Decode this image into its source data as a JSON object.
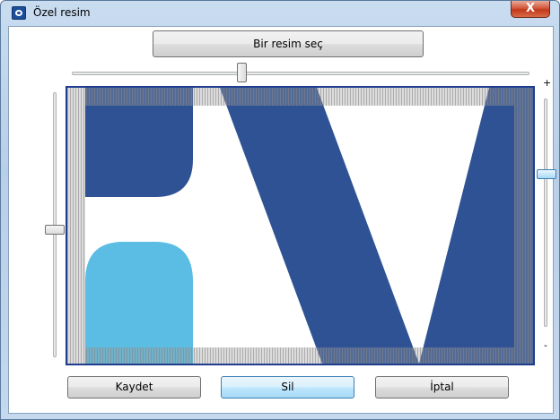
{
  "window": {
    "title": "Özel resim",
    "close_label": "X"
  },
  "toolbar": {
    "choose_image_label": "Bir resim seç"
  },
  "zoom": {
    "plus_label": "+",
    "minus_label": "-",
    "level": 0.55
  },
  "crop": {
    "horizontal_position": 0.37,
    "vertical_position": 0.5
  },
  "colors": {
    "dark_blue": "#2f5294",
    "light_blue": "#5bbde3",
    "frame_border": "#1f3d8f"
  },
  "actions": {
    "save_label": "Kaydet",
    "delete_label": "Sil",
    "cancel_label": "İptal"
  }
}
